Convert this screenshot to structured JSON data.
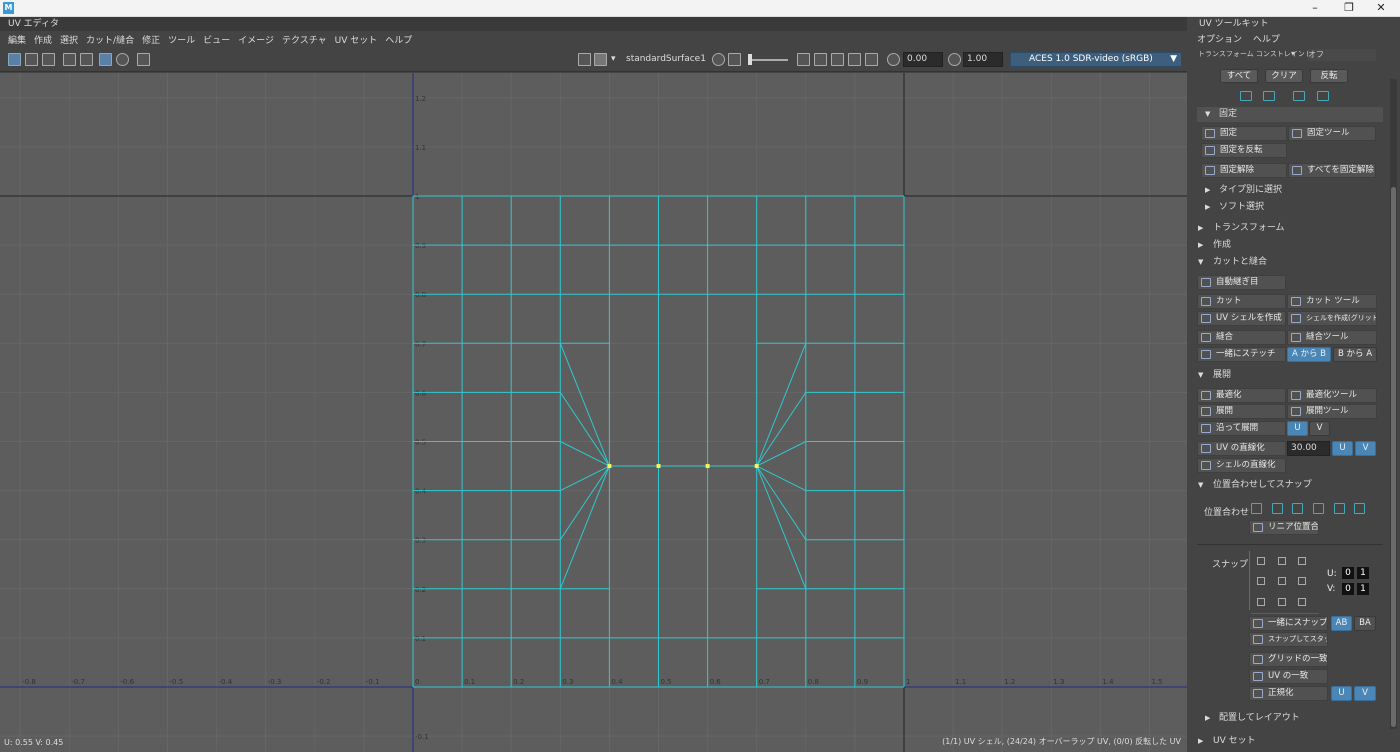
{
  "window": {
    "minimize": "–",
    "restore": "❐",
    "close": "✕"
  },
  "editor": {
    "title": "UV エディタ",
    "menu": [
      "編集",
      "作成",
      "選択",
      "カット/縫合",
      "修正",
      "ツール",
      "ビュー",
      "イメージ",
      "テクスチャ",
      "UV セット",
      "ヘルプ"
    ],
    "material": "standardSurface1",
    "exposure": "0.00",
    "gamma": "1.00",
    "color_space": "ACES 1.0 SDR-video (sRGB)"
  },
  "viewport": {
    "u_ticks": [
      "-0.8",
      "-0.7",
      "-0.6",
      "-0.5",
      "-0.4",
      "-0.3",
      "-0.2",
      "-0.1",
      "0",
      "0.1",
      "0.2",
      "0.3",
      "0.4",
      "0.5",
      "0.6",
      "0.7",
      "0.8",
      "0.9",
      "1",
      "1.1",
      "1.2",
      "1.3",
      "1.4",
      "1.5"
    ],
    "v_ticks": [
      "1.2",
      "1.1",
      "1",
      "0.9",
      "0.8",
      "0.7",
      "0.6",
      "0.5",
      "0.4",
      "0.3",
      "0.2",
      "0.1",
      "-0.1"
    ],
    "coord_readout": "U: 0.55 V: 0.45",
    "status": "(1/1) UV シェル, (24/24) オーバーラップ UV, (0/0) 反転した UV",
    "colors": {
      "background": "#5d5d5d",
      "mesh": "#2fc8cf",
      "axis": "#222",
      "selected_vertex": "#f5f55a"
    }
  },
  "toolkit": {
    "title": "UV ツールキット",
    "menu": [
      "オプション",
      "ヘルプ"
    ],
    "constraint_label": "トランスフォーム コンストレイント:",
    "constraint_value": "オフ",
    "btn_all": "すべて",
    "btn_clear": "クリア",
    "btn_invert": "反転",
    "pin": {
      "title": "固定",
      "pin": "固定",
      "pin_tool": "固定ツール",
      "invert_pin": "固定を反転",
      "unpin": "固定解除",
      "unpin_all": "すべてを固定解除"
    },
    "select_by_type": "タイプ別に選択",
    "soft_select": "ソフト選択",
    "transform": "トランスフォーム",
    "create": "作成",
    "cut_sew": {
      "title": "カットと縫合",
      "auto_seams": "自動継ぎ目",
      "cut": "カット",
      "cut_tool": "カット ツール",
      "create_shell": "UV シェルを作成",
      "create_shell_grid": "シェルを作成(グリッド)",
      "sew": "縫合",
      "sew_tool": "縫合ツール",
      "stitch_together": "一緒にステッチ",
      "a_to_b": "A から B",
      "b_to_a": "B から A"
    },
    "unfold": {
      "title": "展開",
      "optimize": "最適化",
      "optimize_tool": "最適化ツール",
      "unfold": "展開",
      "unfold_tool": "展開ツール",
      "unfold_along": "沿って展開",
      "u": "U",
      "v": "V",
      "straighten_uv": "UV の直線化",
      "angle": "30.00",
      "straighten_shell": "シェルの直線化"
    },
    "align_snap": {
      "title": "位置合わせしてスナップ",
      "align_label": "位置合わせ",
      "linear_align": "リニア位置合わせ",
      "snap_label": "スナップ",
      "u_label": "U:",
      "v_label": "V:",
      "zero": "0",
      "one": "1",
      "snap_together": "一緒にスナップ",
      "ab": "AB",
      "ba": "BA",
      "snap_stack": "スナップしてスタック",
      "match_grid": "グリッドの一致",
      "match_uv": "UV の一致",
      "normalize": "正規化"
    },
    "arrange_layout": "配置してレイアウト",
    "uv_sets": "UV セット"
  }
}
